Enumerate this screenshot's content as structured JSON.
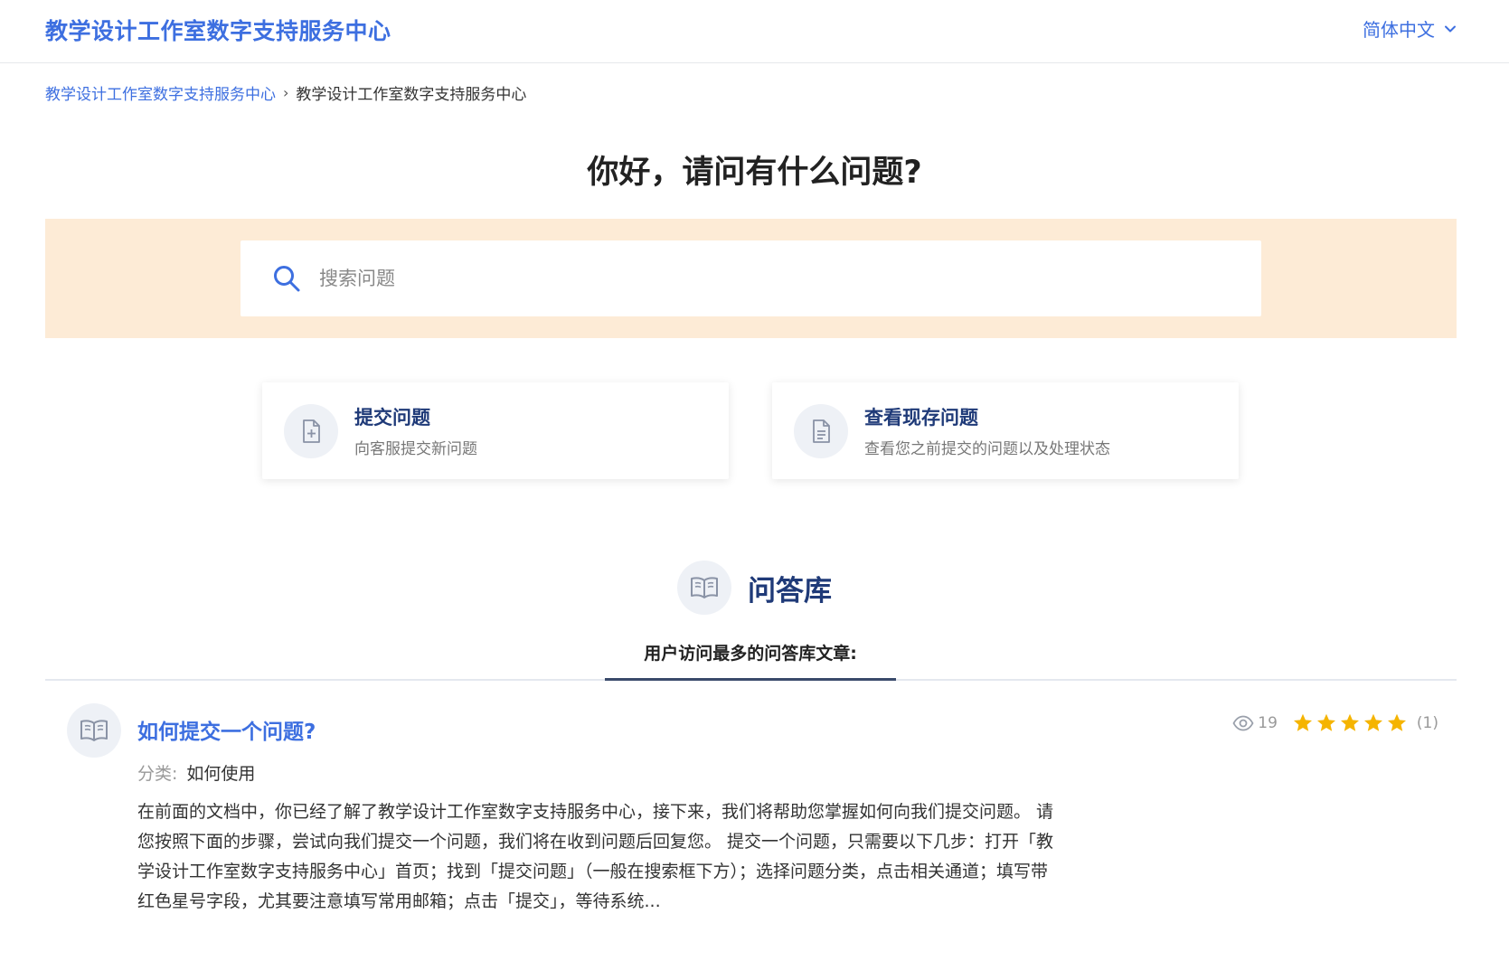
{
  "header": {
    "brand": "教学设计工作室数字支持服务中心",
    "language": "简体中文"
  },
  "breadcrumb": {
    "home": "教学设计工作室数字支持服务中心",
    "separator": "›",
    "current": "教学设计工作室数字支持服务中心"
  },
  "hero": {
    "greeting": "你好，请问有什么问题?",
    "search_placeholder": "搜索问题"
  },
  "actions": [
    {
      "title": "提交问题",
      "desc": "向客服提交新问题",
      "icon": "file-plus-icon"
    },
    {
      "title": "查看现存问题",
      "desc": "查看您之前提交的问题以及处理状态",
      "icon": "file-text-icon"
    }
  ],
  "knowledge_base": {
    "title": "问答库",
    "icon": "open-book-icon",
    "tab_label": "用户访问最多的问答库文章:"
  },
  "articles": [
    {
      "title": "如何提交一个问题?",
      "category_label": "分类:",
      "category": "如何使用",
      "excerpt": "在前面的文档中，你已经了解了教学设计工作室数字支持服务中心，接下来，我们将帮助您掌握如何向我们提交问题。 请您按照下面的步骤，尝试向我们提交一个问题，我们将在收到问题后回复您。  提交一个问题，只需要以下几步：打开「教学设计工作室数字支持服务中心」首页；找到「提交问题」（一般在搜索框下方）；选择问题分类，点击相关通道；填写带红色星号字段，尤其要注意填写常用邮箱；点击「提交」，等待系统...",
      "views": "19",
      "rating": 5,
      "rating_count": "(1)"
    }
  ],
  "colors": {
    "accent": "#3d6fe0",
    "navy": "#1f3a78",
    "search_band": "#fdebd6",
    "star": "#f5b400"
  }
}
